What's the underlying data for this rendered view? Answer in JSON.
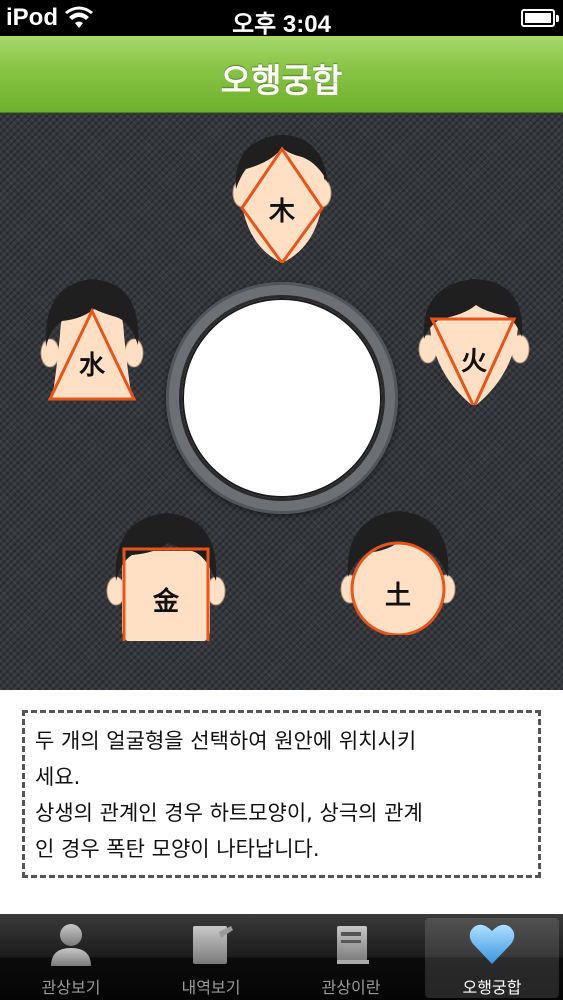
{
  "status_bar": {
    "carrier": "iPod",
    "time": "오후 3:04"
  },
  "nav": {
    "title": "오행궁합"
  },
  "faces": [
    {
      "element": "木",
      "shape": "diamond"
    },
    {
      "element": "火",
      "shape": "inverted-triangle"
    },
    {
      "element": "土",
      "shape": "circle"
    },
    {
      "element": "金",
      "shape": "square"
    },
    {
      "element": "水",
      "shape": "triangle"
    }
  ],
  "instructions": {
    "text": " 두 개의 얼굴형을 선택하여 원안에 위치시키\n세요.\n상생의 관계인 경우 하트모양이, 상극의 관계\n인 경우 폭탄 모양이 나타납니다."
  },
  "tabs": [
    {
      "label": "관상보기",
      "icon": "person-icon",
      "active": false
    },
    {
      "label": "내역보기",
      "icon": "notepad-icon",
      "active": false
    },
    {
      "label": "관상이란",
      "icon": "book-icon",
      "active": false
    },
    {
      "label": "오행궁합",
      "icon": "heart-icon",
      "active": true
    }
  ],
  "colors": {
    "nav_green": "#86c344",
    "outline_orange": "#e8541a",
    "skin": "#ffe0c4",
    "hair": "#1f1f1f",
    "heart_blue": "#5fb0ef"
  }
}
